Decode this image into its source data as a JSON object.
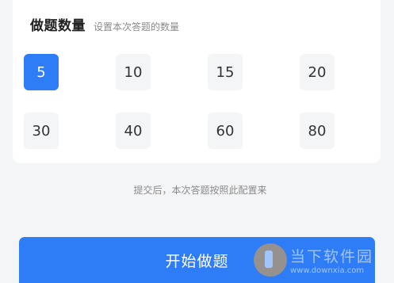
{
  "header": {
    "title": "做题数量",
    "subtitle": "设置本次答题的数量"
  },
  "options": [
    {
      "label": "5",
      "selected": true
    },
    {
      "label": "10",
      "selected": false
    },
    {
      "label": "15",
      "selected": false
    },
    {
      "label": "20",
      "selected": false
    },
    {
      "label": "30",
      "selected": false
    },
    {
      "label": "40",
      "selected": false
    },
    {
      "label": "60",
      "selected": false
    },
    {
      "label": "80",
      "selected": false
    }
  ],
  "hint": "提交后，本次答题按照此配置来",
  "start_button": "开始做题",
  "watermark": {
    "name": "当下软件园",
    "url": "www.downxia.com"
  },
  "colors": {
    "accent": "#2f7df6",
    "background": "#f4f5f7"
  }
}
